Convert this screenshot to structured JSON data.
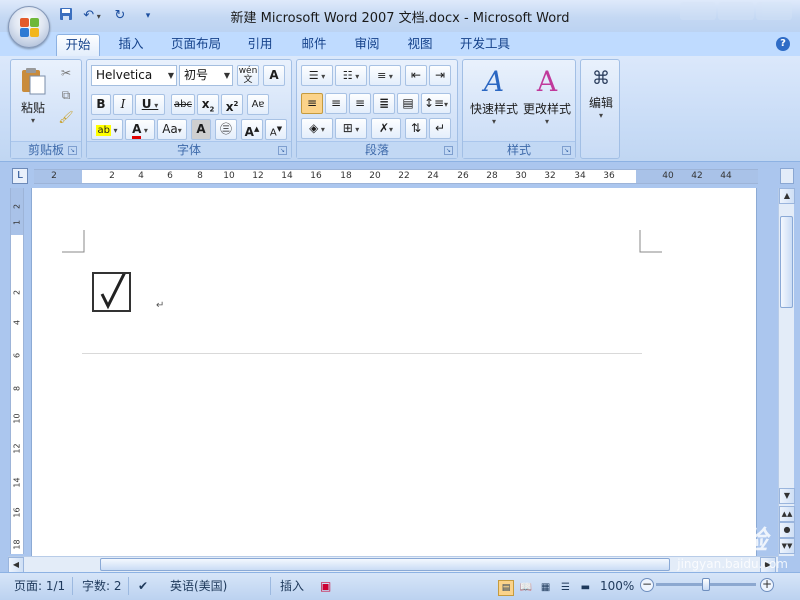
{
  "window": {
    "title": "新建 Microsoft Word 2007 文档.docx - Microsoft Word"
  },
  "ribbon_tabs": [
    {
      "label": "开始",
      "active": true
    },
    {
      "label": "插入"
    },
    {
      "label": "页面布局"
    },
    {
      "label": "引用"
    },
    {
      "label": "邮件"
    },
    {
      "label": "审阅"
    },
    {
      "label": "视图"
    },
    {
      "label": "开发工具"
    }
  ],
  "groups": {
    "clipboard": {
      "label": "剪贴板",
      "paste_label": "粘贴"
    },
    "font": {
      "label": "字体",
      "font_name": "Helvetica",
      "font_size": "初号",
      "phonetic_icon": "wén"
    },
    "paragraph": {
      "label": "段落"
    },
    "styles": {
      "label": "样式",
      "quick_styles": "快速样式",
      "change_styles": "更改样式"
    },
    "editing": {
      "label": "编辑"
    }
  },
  "ruler": {
    "ticks": [
      "2",
      "2",
      "4",
      "6",
      "8",
      "10",
      "12",
      "14",
      "16",
      "18",
      "20",
      "22",
      "24",
      "26",
      "28",
      "30",
      "32",
      "34",
      "36",
      "40",
      "42",
      "44"
    ],
    "vticks": [
      "2",
      "1",
      "2",
      "4",
      "6",
      "8",
      "10",
      "12",
      "14",
      "16",
      "18"
    ]
  },
  "document": {
    "paragraph_mark": "↵"
  },
  "statusbar": {
    "page": "页面: 1/1",
    "words": "字数: 2",
    "language": "英语(美国)",
    "mode": "插入",
    "zoom": "100%"
  },
  "watermark": {
    "text": "Bai du 经验",
    "url": "jingyan.baidu.com"
  },
  "colors": {
    "accent": "#15428b",
    "ribbon_bg": "#c7dbf6",
    "highlight_yellow": "#ffff00",
    "font_red": "#e00000",
    "active_align": "#fbd38a"
  }
}
